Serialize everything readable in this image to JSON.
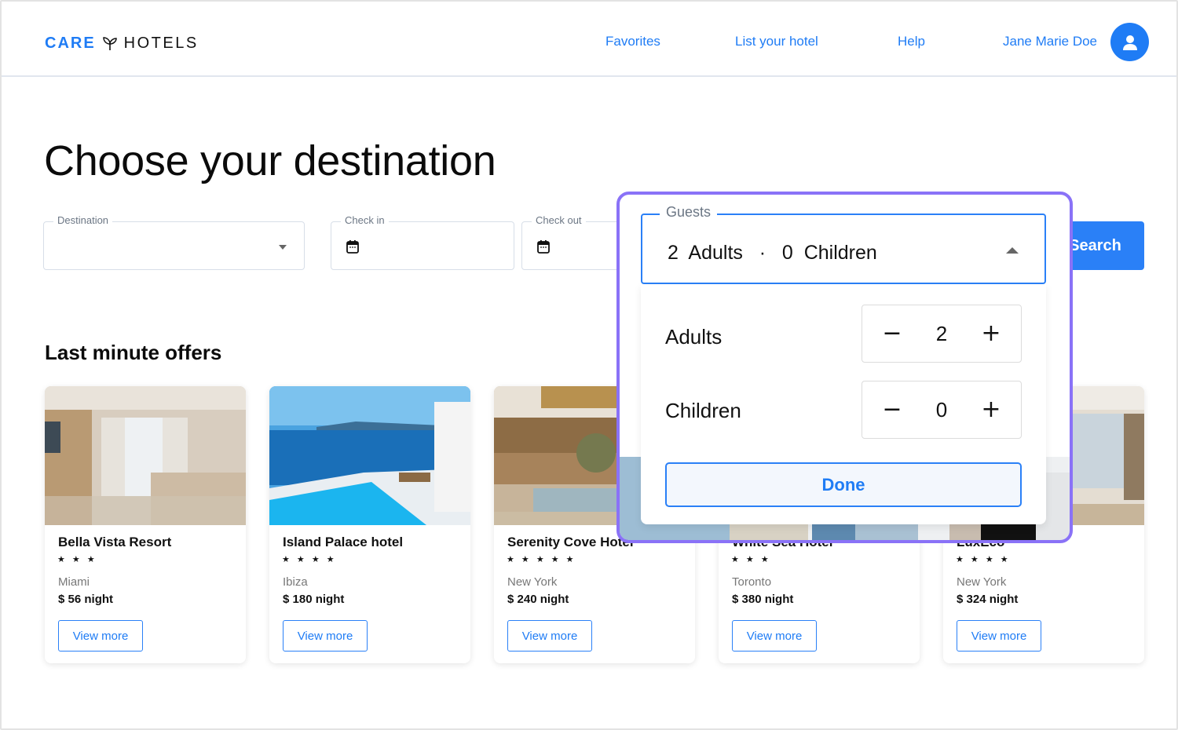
{
  "header": {
    "logo_primary": "CARE",
    "logo_secondary": "HOTELS",
    "nav": [
      "Favorites",
      "List your hotel",
      "Help"
    ],
    "user_name": "Jane Marie Doe",
    "accent_color": "#1f7cf5"
  },
  "main": {
    "title": "Choose your destination",
    "search": {
      "destination_label": "Destination",
      "destination_value": "",
      "checkin_label": "Check in",
      "checkin_value": "",
      "checkout_label": "Check out",
      "checkout_value": "",
      "search_label": "Search"
    },
    "offers_title": "Last minute offers",
    "offers": [
      {
        "name": "Bella Vista Resort",
        "stars": "★ ★ ★",
        "city": "Miami",
        "price": "$ 56 night",
        "cta": "View more"
      },
      {
        "name": "Island Palace hotel",
        "stars": "★ ★ ★ ★",
        "city": "Ibiza",
        "price": "$ 180 night",
        "cta": "View more"
      },
      {
        "name": "Serenity Cove Hotel",
        "stars": "★ ★ ★ ★ ★",
        "city": "New York",
        "price": "$ 240 night",
        "cta": "View more"
      },
      {
        "name": "White Sea Hotel",
        "stars": "★ ★ ★",
        "city": "Toronto",
        "price": "$ 380 night",
        "cta": "View more"
      },
      {
        "name": "LuxEco",
        "stars": "★ ★ ★ ★",
        "city": "New York",
        "price": "$ 324 night",
        "cta": "View more"
      }
    ]
  },
  "guests_popover": {
    "label": "Guests",
    "summary": "2  Adults   ·   0  Children",
    "rows": [
      {
        "label": "Adults",
        "value": "2",
        "minus": "−",
        "plus": "+"
      },
      {
        "label": "Children",
        "value": "0",
        "minus": "−",
        "plus": "+"
      }
    ],
    "done_label": "Done",
    "highlight_color": "#8a72f7"
  }
}
